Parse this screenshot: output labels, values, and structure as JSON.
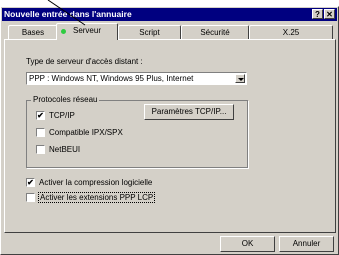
{
  "window": {
    "title": "Nouvelle entrée dans l'annuaire",
    "help_btn": "?",
    "close_btn": "✕"
  },
  "tabs": [
    {
      "label": "Bases",
      "active": false
    },
    {
      "label": "Serveur",
      "active": true
    },
    {
      "label": "Script",
      "active": false
    },
    {
      "label": "Sécurité",
      "active": false
    },
    {
      "label": "X.25",
      "active": false
    }
  ],
  "server": {
    "type_label": "Type de serveur d'accès distant :",
    "type_value": "PPP : Windows NT, Windows 95 Plus, Internet"
  },
  "protocols": {
    "group_label": "Protocoles réseau",
    "items": [
      {
        "label": "TCP/IP",
        "checked": true
      },
      {
        "label": "Compatible IPX/SPX",
        "checked": false
      },
      {
        "label": "NetBEUI",
        "checked": false
      }
    ],
    "settings_button": "Paramètres TCP/IP..."
  },
  "options": [
    {
      "label": "Activer la compression logicielle",
      "checked": true
    },
    {
      "label": "Activer les extensions PPP LCP",
      "checked": false
    }
  ],
  "buttons": {
    "ok": "OK",
    "cancel": "Annuler"
  },
  "check_mark": "✔"
}
